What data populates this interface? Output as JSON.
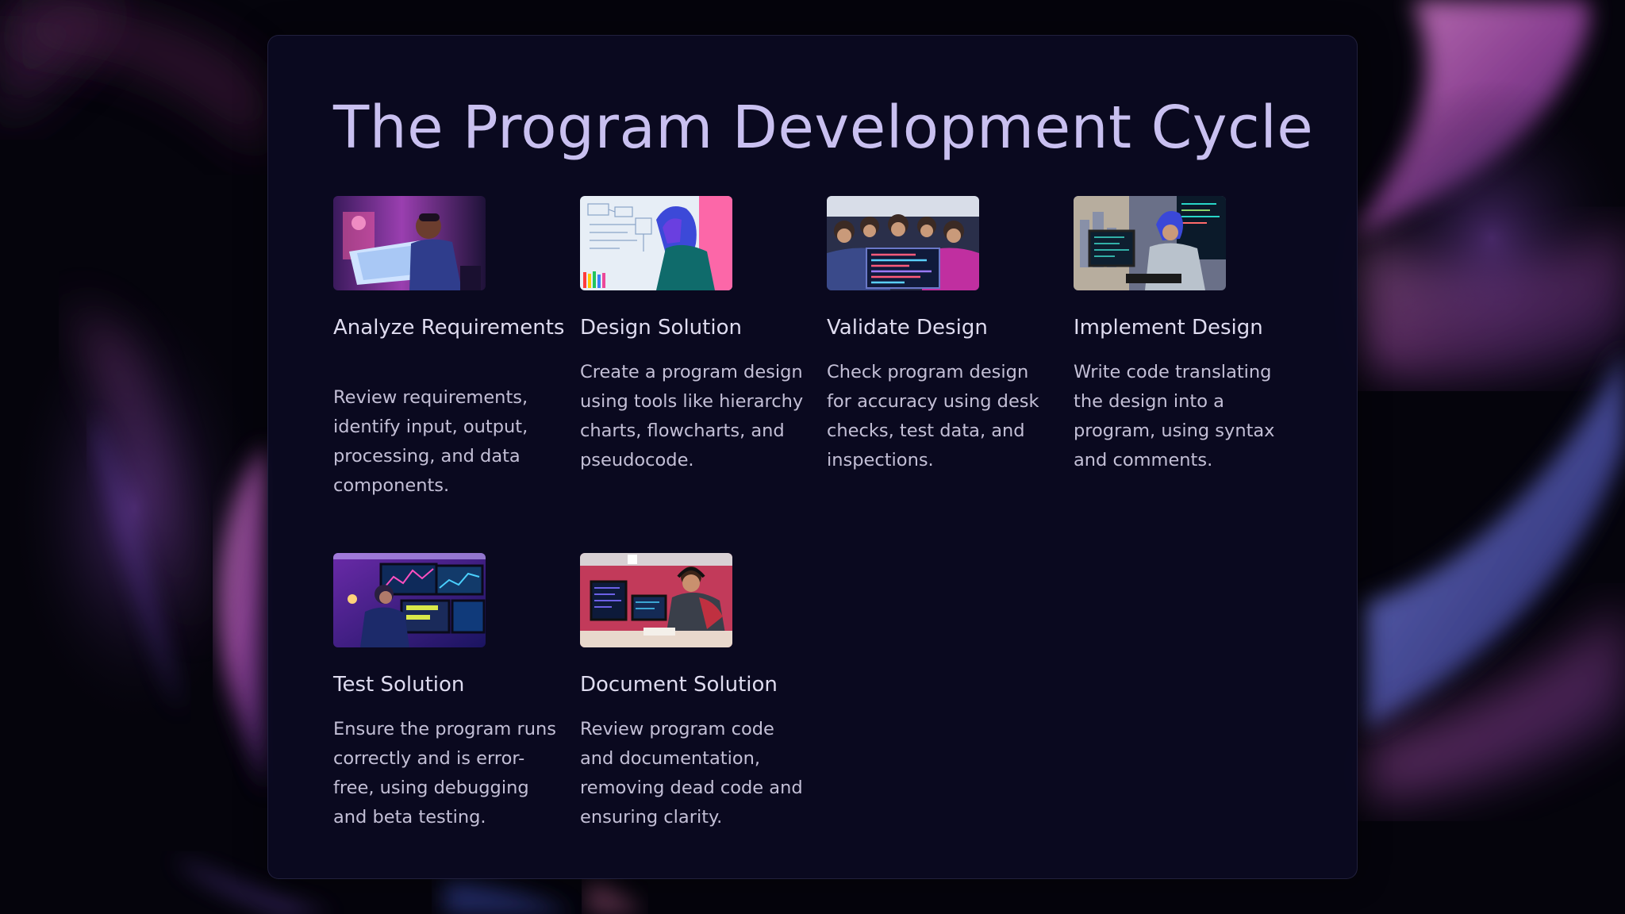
{
  "slide": {
    "title": "The Program Development Cycle",
    "accent_color": "#c9c0f0",
    "steps": [
      {
        "heading": "Analyze Requirements",
        "description": "Review requirements, identify input, output, processing, and data components.",
        "image": "developer-reading-document-photo"
      },
      {
        "heading": "Design Solution",
        "description": "Create a program design using tools like hierarchy charts, flowcharts, and pseudocode.",
        "image": "designer-at-whiteboard-photo"
      },
      {
        "heading": "Validate Design",
        "description": "Check program design for accuracy using desk checks, test data, and inspections.",
        "image": "team-reviewing-screen-photo"
      },
      {
        "heading": "Implement Design",
        "description": "Write code translating the design into a program, using syntax and comments.",
        "image": "developer-coding-photo"
      },
      {
        "heading": "Test Solution",
        "description": "Ensure the program runs correctly and is error-free, using debugging and beta testing.",
        "image": "developer-multiple-monitors-photo"
      },
      {
        "heading": "Document Solution",
        "description": "Review program code and documentation, removing dead code and ensuring clarity.",
        "image": "developer-with-headphones-photo"
      }
    ]
  }
}
